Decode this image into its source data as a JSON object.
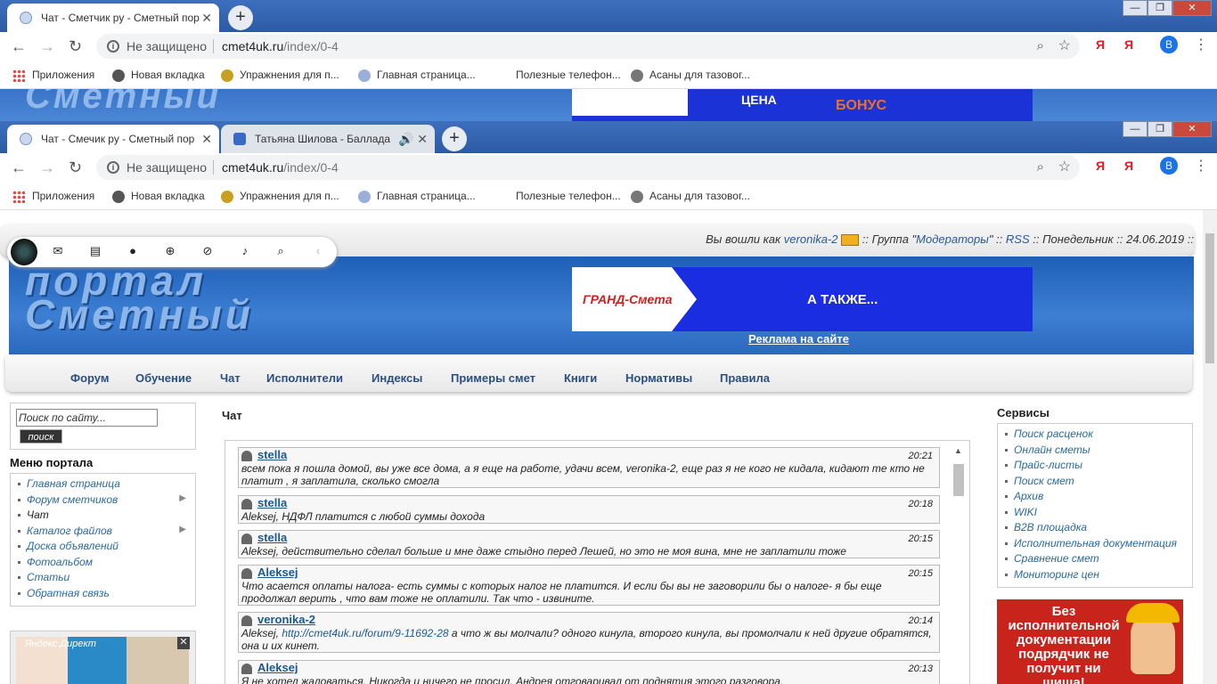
{
  "back_window": {
    "tab1_title": "Чат - Сметчик ру - Сметный пор",
    "security": "Не защищено",
    "url_host": "cmet4uk.ru",
    "url_path": "/index/0-4",
    "banner_price": "ЦЕНА",
    "banner_bonus": "БОНУС"
  },
  "front_window": {
    "tab1_title": "Чат - Смечик ру - Сметный пор",
    "tab2_title": "Татьяна Шилова - Баллада",
    "security": "Не защищено",
    "url_host": "cmet4uk.ru",
    "url_path": "/index/0-4"
  },
  "bookmarks": [
    {
      "label": "Приложения",
      "icon": "apps-grid-icon"
    },
    {
      "label": "Новая вкладка",
      "icon": "globe-icon"
    },
    {
      "label": "Упражнения для п...",
      "icon": "site-icon"
    },
    {
      "label": "Главная страница...",
      "icon": "site-icon"
    },
    {
      "label": "Полезные телефон...",
      "icon": "none"
    },
    {
      "label": "Асаны для тазовог...",
      "icon": "yoga-icon"
    }
  ],
  "toolbar": {
    "ya1": "Я",
    "ya2": "Я",
    "avatar": "В"
  },
  "userbar": {
    "prefix": "Вы вошли как",
    "username": "veronika-2",
    "group_prefix": ":: Группа \"",
    "group": "Модераторы",
    "group_suffix": "\" ::",
    "rss": "RSS",
    "date": ":: Понедельник :: 24.06.2019 ::"
  },
  "header": {
    "logo": "Сметный портал",
    "ad_brand": "ГРАНД-Смета",
    "ad_text": "А ТАКЖЕ...",
    "ad_link": "Реклама на сайте"
  },
  "nav": [
    "Форум",
    "Обучение",
    "Чат",
    "Исполнители",
    "Индексы",
    "Примеры смет",
    "Книги",
    "Нормативы",
    "Правила"
  ],
  "search": {
    "placeholder": "Поиск по сайту...",
    "button": "поиск"
  },
  "menu": {
    "title": "Меню портала",
    "items": [
      "Главная страница",
      "Форум сметчиков",
      "Чат",
      "Каталог файлов",
      "Доска объявлений",
      "Фотоальбом",
      "Статьи",
      "Обратная связь"
    ]
  },
  "direct": {
    "label": "Яндекс.Директ",
    "close": "✕"
  },
  "chat": {
    "title": "Чат",
    "messages": [
      {
        "user": "stella",
        "time": "20:21",
        "text": "всем пока я пошла домой, вы уже все дома, а я еще на работе, удачи всем, veronika-2, еще раз я не кого не кидала, кидают те кто не платит , я заплатила, сколько смогла"
      },
      {
        "user": "stella",
        "time": "20:18",
        "text": "Aleksej, НДФЛ платится с любой суммы дохода"
      },
      {
        "user": "stella",
        "time": "20:15",
        "text": "Aleksej, действительно сделал больше и мне даже стыдно перед Лешей, но это не моя вина, мне не заплатили тоже"
      },
      {
        "user": "Aleksej",
        "time": "20:15",
        "text": "Что асается оплаты налога- есть суммы с которых налог не платится. И если бы вы не заговорили бы о налоге- я бы еще продолжал верить , что вам тоже не оплатили. Так что - извините."
      },
      {
        "user": "veronika-2",
        "time": "20:14",
        "text_before": "Aleksej, ",
        "link": "http://cmet4uk.ru/forum/9-11692-28",
        "text_after": " а что ж вы молчали? одного кинула, второго кинула, вы промолчали к ней другие обратятся, она и их кинет."
      },
      {
        "user": "Aleksej",
        "time": "20:13",
        "text": "Я не хотел жаловаться. Никогда и ничего не просил. Андрея отговаривал от поднятия этого разговора."
      }
    ]
  },
  "services": {
    "title": "Сервисы",
    "items": [
      "Поиск расценок",
      "Онлайн сметы",
      "Прайс-листы",
      "Поиск смет",
      "Архив",
      "WIKI",
      "B2B площадка",
      "Исполнительная документация",
      "Сравнение смет",
      "Мониторинг цен"
    ]
  },
  "promo": {
    "text": "Без исполнительной документации подрядчик не получит ни шиша!"
  }
}
